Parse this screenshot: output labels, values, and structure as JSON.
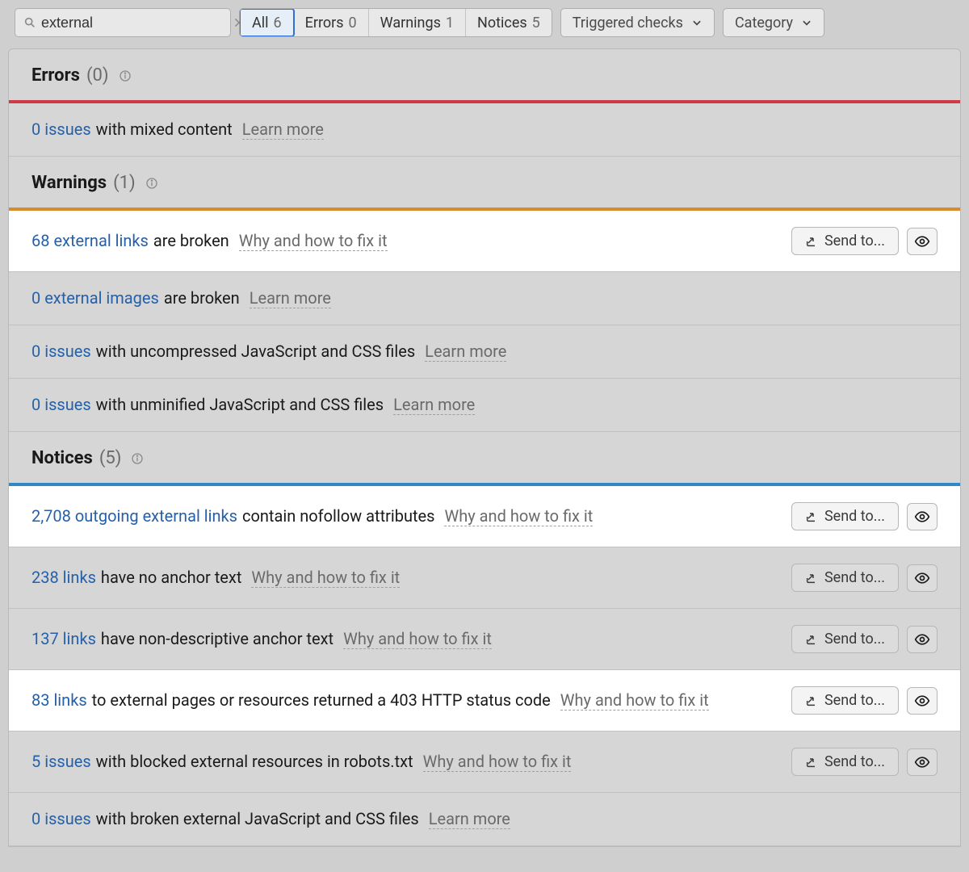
{
  "toolbar": {
    "search_value": "external",
    "tabs": [
      {
        "label": "All",
        "count": "6",
        "active": true
      },
      {
        "label": "Errors",
        "count": "0",
        "active": false
      },
      {
        "label": "Warnings",
        "count": "1",
        "active": false
      },
      {
        "label": "Notices",
        "count": "5",
        "active": false
      }
    ],
    "triggered_label": "Triggered checks",
    "category_label": "Category"
  },
  "sections": {
    "errors": {
      "title": "Errors",
      "count": "(0)"
    },
    "warnings": {
      "title": "Warnings",
      "count": "(1)"
    },
    "notices": {
      "title": "Notices",
      "count": "(5)"
    }
  },
  "rows": {
    "e1": {
      "link": "0 issues",
      "desc": "with mixed content",
      "hint": "Learn more"
    },
    "w1": {
      "link": "68 external links",
      "desc": "are broken",
      "hint": "Why and how to fix it"
    },
    "w2": {
      "link": "0 external images",
      "desc": "are broken",
      "hint": "Learn more"
    },
    "w3": {
      "link": "0 issues",
      "desc": "with uncompressed JavaScript and CSS files",
      "hint": "Learn more"
    },
    "w4": {
      "link": "0 issues",
      "desc": "with unminified JavaScript and CSS files",
      "hint": "Learn more"
    },
    "n1": {
      "link": "2,708 outgoing external links",
      "desc": "contain nofollow attributes",
      "hint": "Why and how to fix it"
    },
    "n2": {
      "link": "238 links",
      "desc": "have no anchor text",
      "hint": "Why and how to fix it"
    },
    "n3": {
      "link": "137 links",
      "desc": "have non-descriptive anchor text",
      "hint": "Why and how to fix it"
    },
    "n4": {
      "link": "83 links",
      "desc": "to external pages or resources returned a 403 HTTP status code",
      "hint": "Why and how to fix it"
    },
    "n5": {
      "link": "5 issues",
      "desc": "with blocked external resources in robots.txt",
      "hint": "Why and how to fix it"
    },
    "n6": {
      "link": "0 issues",
      "desc": "with broken external JavaScript and CSS files",
      "hint": "Learn more"
    }
  },
  "buttons": {
    "send_to": "Send to..."
  }
}
